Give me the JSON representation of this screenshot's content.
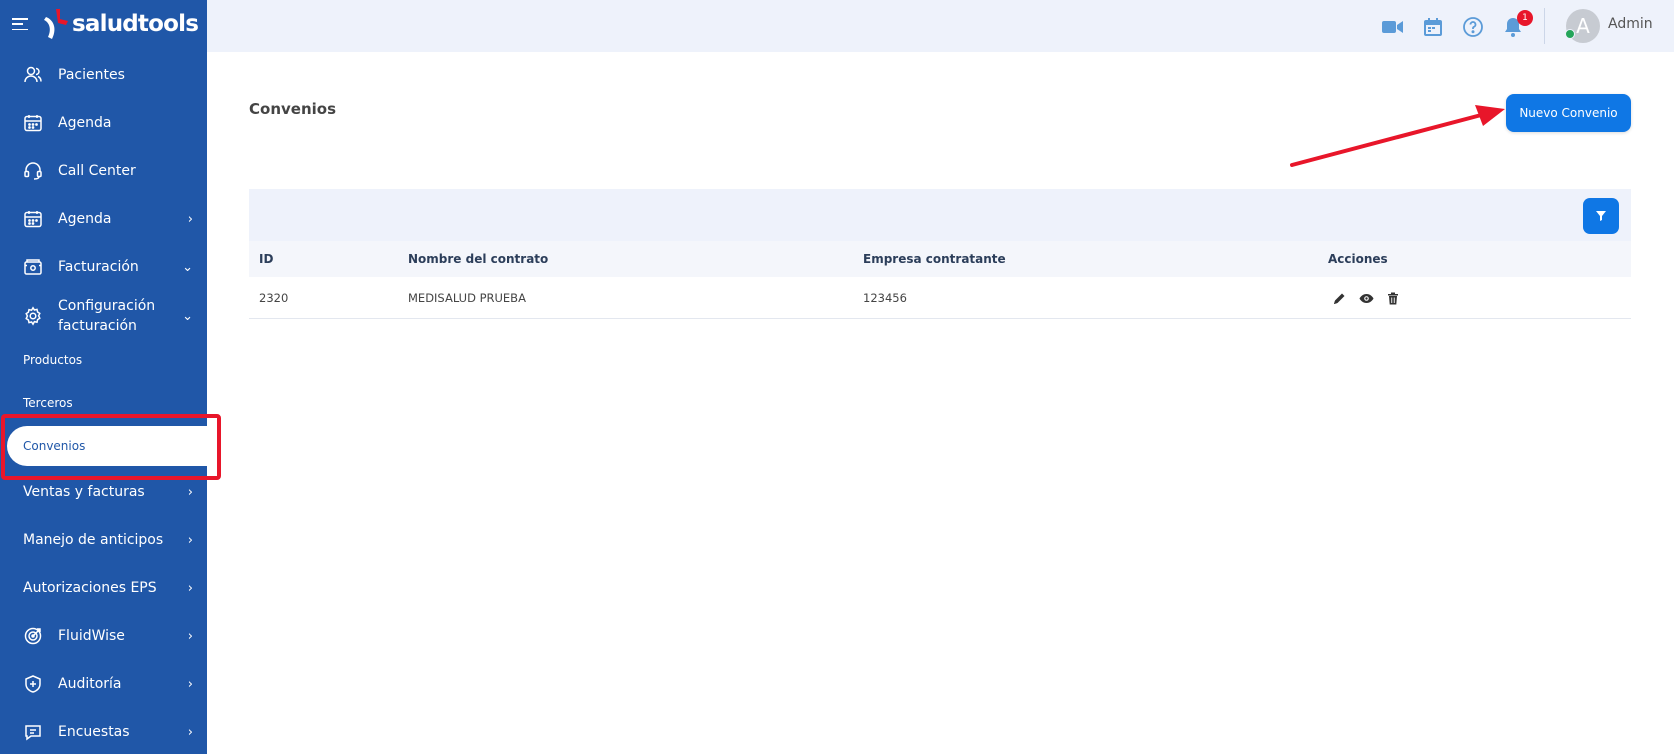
{
  "brand": {
    "name": "saludtools"
  },
  "sidebar": {
    "items": [
      {
        "label": "Pacientes",
        "icon": "users-icon"
      },
      {
        "label": "Agenda",
        "icon": "calendar-icon"
      },
      {
        "label": "Call Center",
        "icon": "headset-icon"
      },
      {
        "label": "Agenda",
        "icon": "calendar-icon"
      },
      {
        "label": "Facturación",
        "icon": "billing-icon"
      },
      {
        "label": "Configuración facturación",
        "line1": "Configuración",
        "line2": "facturación",
        "icon": "gear-icon"
      }
    ],
    "subitems": [
      {
        "label": "Productos"
      },
      {
        "label": "Terceros"
      },
      {
        "label": "Convenios",
        "active": true
      }
    ],
    "lower_items": [
      {
        "label": "Ventas y facturas"
      },
      {
        "label": "Manejo de anticipos"
      },
      {
        "label": "Autorizaciones EPS"
      },
      {
        "label": "FluidWise",
        "icon": "target-icon"
      },
      {
        "label": "Auditoría",
        "icon": "shield-icon"
      },
      {
        "label": "Encuestas",
        "icon": "chat-icon"
      }
    ]
  },
  "topbar": {
    "notifications_count": "1",
    "user": {
      "name": "Admin",
      "initial": "A"
    }
  },
  "page": {
    "title": "Convenios",
    "new_button": "Nuevo Convenio"
  },
  "table": {
    "columns": [
      "ID",
      "Nombre del contrato",
      "Empresa contratante",
      "Acciones"
    ],
    "rows": [
      {
        "id": "2320",
        "nombre": "MEDISALUD PRUEBA",
        "empresa": "123456"
      }
    ]
  },
  "colors": {
    "sidebar": "#2057a8",
    "primary_button": "#0f77e5",
    "annotation": "#e8162a",
    "topbar": "#eef2fb"
  }
}
